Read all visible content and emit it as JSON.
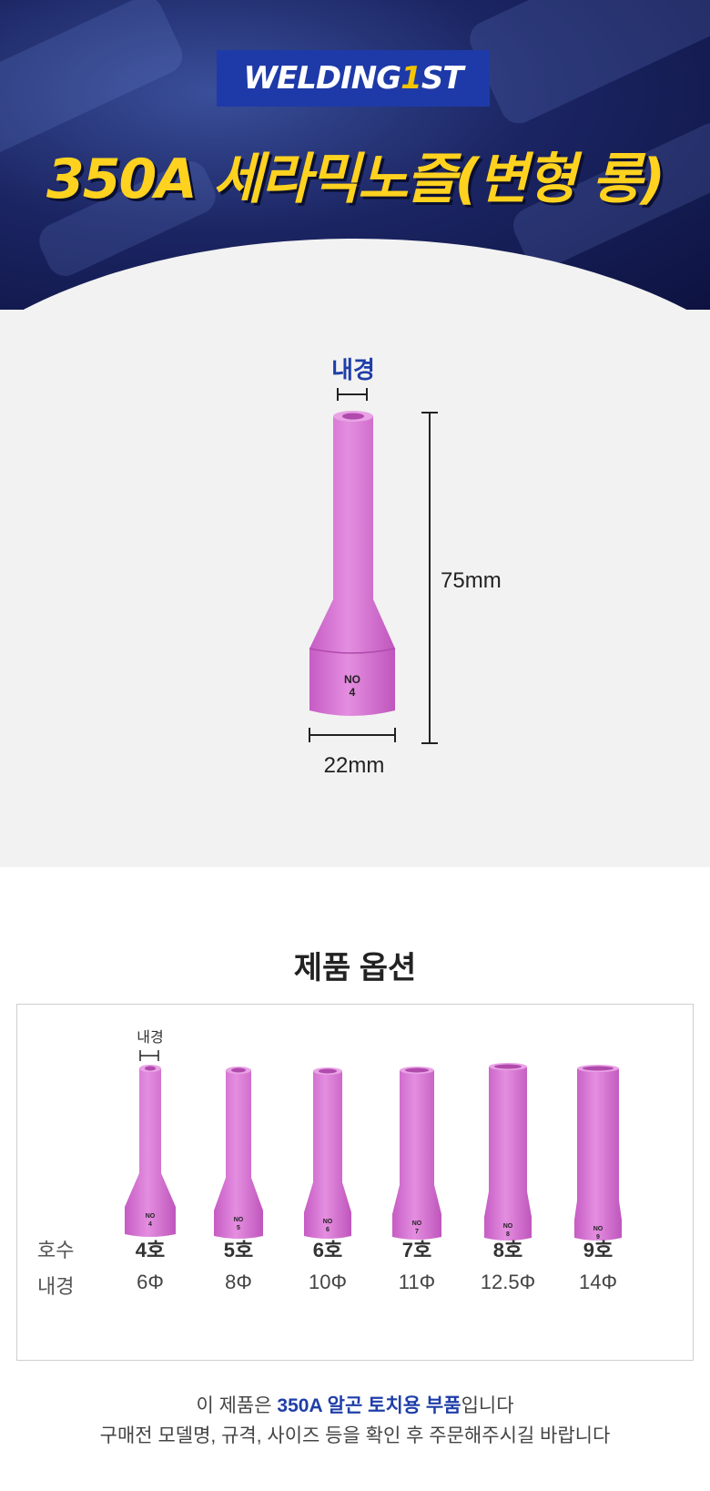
{
  "header": {
    "logo_main": "WELDING",
    "logo_accent": "1",
    "logo_tail": "ST",
    "title": "350A 세라믹노즐(변형 롱)"
  },
  "diagram": {
    "inner_label": "내경",
    "height_label": "75mm",
    "width_label": "22mm",
    "nozzle_marking_no": "NO",
    "nozzle_marking_num": "4"
  },
  "options": {
    "title": "제품 옵션",
    "inner_label": "내경",
    "row_size_label": "호수",
    "row_diameter_label": "내경",
    "items": [
      {
        "size": "4호",
        "diameter": "6Φ",
        "mark": "4"
      },
      {
        "size": "5호",
        "diameter": "8Φ",
        "mark": "5"
      },
      {
        "size": "6호",
        "diameter": "10Φ",
        "mark": "6"
      },
      {
        "size": "7호",
        "diameter": "11Φ",
        "mark": "7"
      },
      {
        "size": "8호",
        "diameter": "12.5Φ",
        "mark": "8"
      },
      {
        "size": "9호",
        "diameter": "14Φ",
        "mark": "9"
      }
    ]
  },
  "notice": {
    "line1_prefix": "이 제품은 ",
    "line1_highlight": "350A 알곤 토치용 부품",
    "line1_suffix": "입니다",
    "line2": "구매전 모델명, 규격, 사이즈 등을 확인 후 주문해주시길 바랍니다"
  },
  "colors": {
    "nozzle": "#e07fd8",
    "accent_blue": "#1f3ea8",
    "title_yellow": "#ffd21f"
  }
}
